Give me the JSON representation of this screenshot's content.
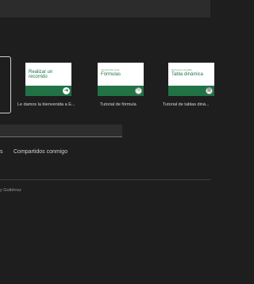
{
  "templates": [
    {
      "small_title": "",
      "title": "Realizar un recorrido",
      "badge_icon": "arrow-right-icon",
      "caption": "Le damos la bienvenida a E..."
    },
    {
      "small_title": "Introducción a las",
      "title": "Fórmulas",
      "badge_icon": "function-icon",
      "caption": "Tutorial de fórmula"
    },
    {
      "small_title": "Recursos a la tabla",
      "title": "Tabla dinámica",
      "badge_icon": "pivot-table-icon",
      "caption": "Tutorial de tablas diná..."
    }
  ],
  "tabs": {
    "partial_label": "s",
    "shared_label": "Compartidos conmigo"
  },
  "file_owner": "y Gutiérrez",
  "colors": {
    "accent": "#217346",
    "background": "#1e1e1e"
  }
}
